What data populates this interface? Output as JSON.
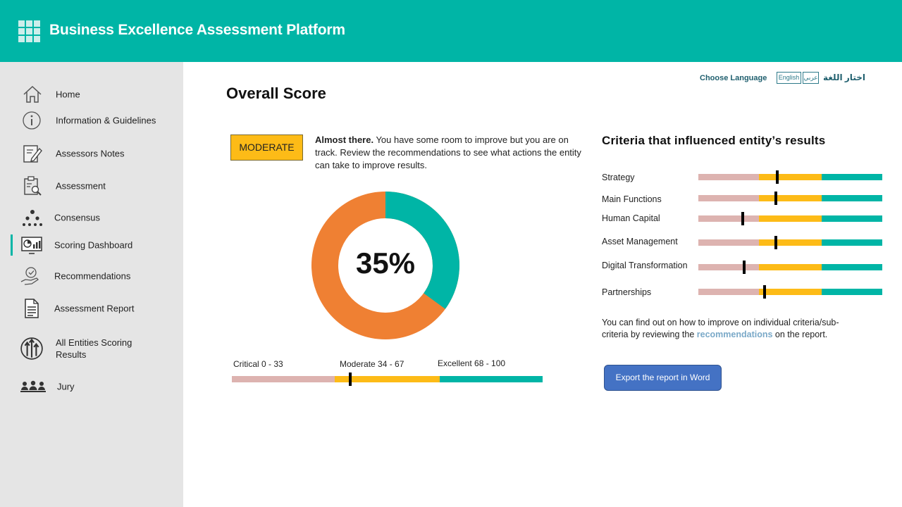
{
  "app": {
    "title": "Business Excellence Assessment Platform"
  },
  "colors": {
    "brand": "#00b5a6",
    "critical": "#ddb3b0",
    "moderate": "#fdbb17",
    "excellent": "#00b5a6",
    "donut_score": "#00b5a6",
    "donut_rest": "#ef8033",
    "button": "#4472c4"
  },
  "sidebar": {
    "items": [
      {
        "label": "Home",
        "icon": "home-icon"
      },
      {
        "label": "Information & Guidelines",
        "icon": "info-icon"
      },
      {
        "label": "Assessors  Notes",
        "icon": "note-edit-icon"
      },
      {
        "label": "Assessment",
        "icon": "clipboard-search-icon"
      },
      {
        "label": "Consensus",
        "icon": "hierarchy-icon"
      },
      {
        "label": "Scoring Dashboard",
        "icon": "dashboard-icon",
        "active": true
      },
      {
        "label": "Recommendations",
        "icon": "hand-check-icon"
      },
      {
        "label": "Assessment  Report",
        "icon": "document-icon"
      },
      {
        "label": "All Entities Scoring Results",
        "icon": "arrows-up-icon"
      },
      {
        "label": "Jury",
        "icon": "group-icon"
      }
    ]
  },
  "language": {
    "choose_label": "Choose Language",
    "english": "English",
    "arabic": "عربي",
    "arabic_label": "اختار اللغة"
  },
  "overall": {
    "heading": "Overall Score",
    "badge": "MODERATE",
    "desc_bold": "Almost there.",
    "desc_text": " You have some room to improve but you are on track. Review the recommendations to see what actions the entity can take to improve results.",
    "score_percent": 35,
    "score_label": "35%"
  },
  "scale": {
    "critical_label": "Critical 0 - 33",
    "moderate_label": "Moderate 34 - 67",
    "excellent_label": "Excellent 68 - 100",
    "marker_value": 38
  },
  "criteria": {
    "heading": "Criteria that influenced entity’s results",
    "items": [
      {
        "name": "Strategy",
        "value": 43
      },
      {
        "name": "Main Functions",
        "value": 42
      },
      {
        "name": "Human Capital",
        "value": 24
      },
      {
        "name": "Asset Management",
        "value": 42
      },
      {
        "name": "Digital Transformation",
        "value": 25
      },
      {
        "name": "Partnerships",
        "value": 36
      }
    ]
  },
  "note": {
    "text_before": "You can find out on how to improve on individual criteria/sub-criteria by reviewing the ",
    "link": "recommendations",
    "text_after": " on the report."
  },
  "export_button": "Export the  report in Word"
}
